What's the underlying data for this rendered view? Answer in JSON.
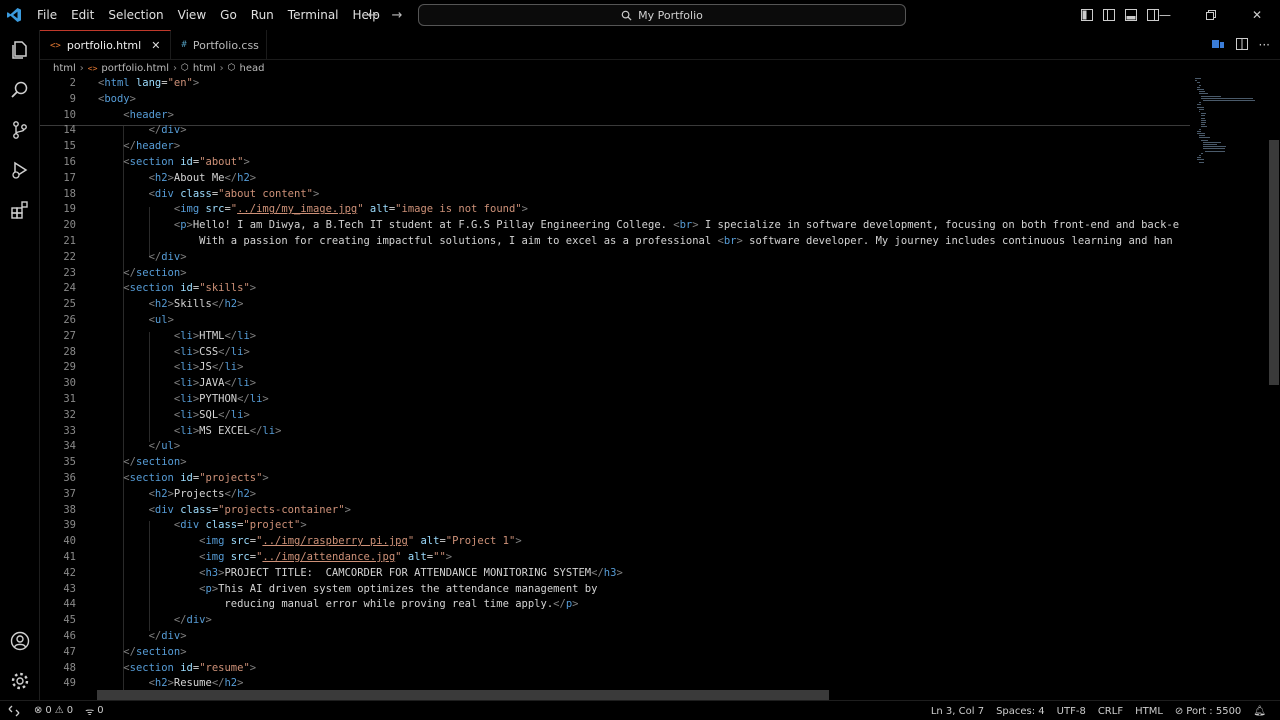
{
  "window": {
    "menu": [
      "File",
      "Edit",
      "Selection",
      "View",
      "Go",
      "Run",
      "Terminal",
      "Help"
    ],
    "search_text": "My Portfolio"
  },
  "tabs": [
    {
      "label": "portfolio.html",
      "type": "html",
      "active": true
    },
    {
      "label": "Portfolio.css",
      "type": "css",
      "active": false
    }
  ],
  "breadcrumb": [
    "html",
    "portfolio.html",
    "html",
    "head"
  ],
  "code_lines": [
    {
      "num": "2",
      "text": "<html lang=\"en\">"
    },
    {
      "num": "9",
      "text": "<body>"
    },
    {
      "num": "10",
      "text": "    <header>"
    },
    {
      "num": "14",
      "text": "        </div>"
    },
    {
      "num": "15",
      "text": "    </header>"
    },
    {
      "num": "16",
      "text": "    <section id=\"about\">"
    },
    {
      "num": "17",
      "text": "        <h2>About Me</h2>"
    },
    {
      "num": "18",
      "text": "        <div class=\"about content\">"
    },
    {
      "num": "19",
      "text": "            <img src=\"../img/my_image.jpg\" alt=\"image is not found\">"
    },
    {
      "num": "20",
      "text": "            <p>Hello! I am Diwya, a B.Tech IT student at F.G.S Pillay Engineering College. <br> I specialize in software development, focusing on both front-end and back-e"
    },
    {
      "num": "21",
      "text": "                With a passion for creating impactful solutions, I aim to excel as a professional <br> software developer. My journey includes continuous learning and han"
    },
    {
      "num": "22",
      "text": "        </div>"
    },
    {
      "num": "23",
      "text": "    </section>"
    },
    {
      "num": "24",
      "text": "    <section id=\"skills\">"
    },
    {
      "num": "25",
      "text": "        <h2>Skills</h2>"
    },
    {
      "num": "26",
      "text": "        <ul>"
    },
    {
      "num": "27",
      "text": "            <li>HTML</li>"
    },
    {
      "num": "28",
      "text": "            <li>CSS</li>"
    },
    {
      "num": "29",
      "text": "            <li>JS</li>"
    },
    {
      "num": "30",
      "text": "            <li>JAVA</li>"
    },
    {
      "num": "31",
      "text": "            <li>PYTHON</li>"
    },
    {
      "num": "32",
      "text": "            <li>SQL</li>"
    },
    {
      "num": "33",
      "text": "            <li>MS EXCEL</li>"
    },
    {
      "num": "34",
      "text": "        </ul>"
    },
    {
      "num": "35",
      "text": "    </section>"
    },
    {
      "num": "36",
      "text": "    <section id=\"projects\">"
    },
    {
      "num": "37",
      "text": "        <h2>Projects</h2>"
    },
    {
      "num": "38",
      "text": "        <div class=\"projects-container\">"
    },
    {
      "num": "39",
      "text": "            <div class=\"project\">"
    },
    {
      "num": "40",
      "text": "                <img src=\"../img/raspberry pi.jpg\" alt=\"Project 1\">"
    },
    {
      "num": "41",
      "text": "                <img src=\"../img/attendance.jpg\" alt=\"\">"
    },
    {
      "num": "42",
      "text": "                <h3>PROJECT TITLE:  CAMCORDER FOR ATTENDANCE MONITORING SYSTEM</h3>"
    },
    {
      "num": "43",
      "text": "                <p>This AI driven system optimizes the attendance management by"
    },
    {
      "num": "44",
      "text": "                    reducing manual error while proving real time apply.</p>"
    },
    {
      "num": "45",
      "text": "            </div>"
    },
    {
      "num": "46",
      "text": "        </div>"
    },
    {
      "num": "47",
      "text": "    </section>"
    },
    {
      "num": "48",
      "text": "    <section id=\"resume\">"
    },
    {
      "num": "49",
      "text": "        <h2>Resume</h2>"
    }
  ],
  "status": {
    "errors": "0",
    "warnings": "0",
    "ports": "0",
    "cursor": "Ln 3, Col 7",
    "spaces": "Spaces: 4",
    "encoding": "UTF-8",
    "eol": "CRLF",
    "language": "HTML",
    "live_server": "Port : 5500"
  },
  "colors": {
    "tag": "#569cd6",
    "attribute": "#9cdcfe",
    "string": "#ce9178",
    "text": "#d4d4d4",
    "line_number": "#8a8a8a",
    "active_tab_border": "#c0392b"
  }
}
